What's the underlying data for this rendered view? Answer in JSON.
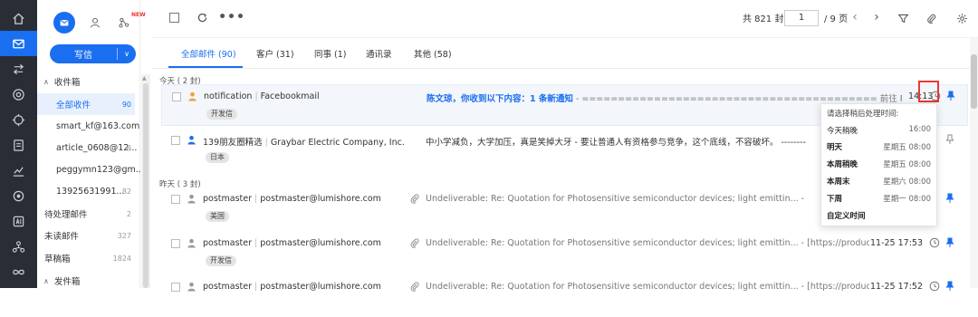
{
  "rail": {
    "items": [
      "home-icon",
      "mail-icon",
      "transfer-icon",
      "at-icon",
      "target-icon",
      "document-icon",
      "chart-icon",
      "settings-circle-icon",
      "ai-icon",
      "network-icon",
      "infinity-icon"
    ]
  },
  "sidebar": {
    "new_badge": "NEW",
    "compose_label": "写信",
    "folders": [
      {
        "label": "收件箱",
        "count": ""
      },
      {
        "label": "全部收件",
        "count": "90"
      },
      {
        "label": "smart_kf@163.com",
        "count": ""
      },
      {
        "label": "article_0608@12...",
        "count": "8"
      },
      {
        "label": "peggymn123@gm...",
        "count": ""
      },
      {
        "label": "13925631991...",
        "count": "82"
      },
      {
        "label": "待处理邮件",
        "count": "2"
      },
      {
        "label": "未读邮件",
        "count": "327"
      },
      {
        "label": "草稿箱",
        "count": "1824"
      },
      {
        "label": "发件箱",
        "count": ""
      }
    ]
  },
  "toolbar": {
    "total": "共 821 封",
    "page_value": "1",
    "page_total": "/ 9 页"
  },
  "tabs": [
    {
      "label": "全部邮件 (90)"
    },
    {
      "label": "客户 (31)"
    },
    {
      "label": "同事 (1)"
    },
    {
      "label": "通讯录"
    },
    {
      "label": "其他 (58)"
    }
  ],
  "groups": {
    "today": "今天 ( 2 封)",
    "yesterday": "昨天 ( 3 封)"
  },
  "emails": [
    {
      "sender": "notification",
      "address": "Facebookmail",
      "tag": "开发信",
      "subject_hl": "陈文琼，你收到以下内容：1 条新通知",
      "preview": " - ========================================= 前往 Facebook https://...",
      "time": "14:13"
    },
    {
      "sender": "139朋友圈精选",
      "address": "Graybar Electric Company, Inc.",
      "tag": "日本",
      "subject_hl": "",
      "preview": "中小学减负，大学加压，真是笑掉大牙 - 要让普通人有资格参与竞争，这个底线，不容破坏。 ---------------------------",
      "time": ""
    },
    {
      "sender": "postmaster",
      "address": "postmaster@lumishore.com",
      "tag": "美国",
      "subject_hl": "",
      "preview": "Undeliverable: Re: Quotation for Photosensitive semiconductor devices; light emittin... - [https://products.office.com/e...",
      "time": ""
    },
    {
      "sender": "postmaster",
      "address": "postmaster@lumishore.com",
      "tag": "开发信",
      "subject_hl": "",
      "preview": "Undeliverable: Re: Quotation for Photosensitive semiconductor devices; light emittin... - [https://products.office.com/e...",
      "time": "11-25 17:53"
    },
    {
      "sender": "postmaster",
      "address": "postmaster@lumishore.com",
      "tag": "",
      "subject_hl": "",
      "preview": "Undeliverable: Re: Quotation for Photosensitive semiconductor devices; light emittin... - [https://products.office.com/e...",
      "time": "11-25 17:52"
    }
  ],
  "popup": {
    "title": "请选择稍后处理时间:",
    "options": [
      {
        "name": "今天稍晚",
        "time": "16:00"
      },
      {
        "name": "明天",
        "time": "星期五 08:00"
      },
      {
        "name": "本周稍晚",
        "time": "星期五 08:00"
      },
      {
        "name": "本周末",
        "time": "星期六 08:00"
      },
      {
        "name": "下周",
        "time": "星期一 08:00"
      }
    ],
    "custom": "自定义时间"
  },
  "colors": {
    "accent": "#1a6ef0",
    "rail_bg": "#2a2d35",
    "annotation_red": "#e53935",
    "sender_icon": "#f0a030"
  }
}
